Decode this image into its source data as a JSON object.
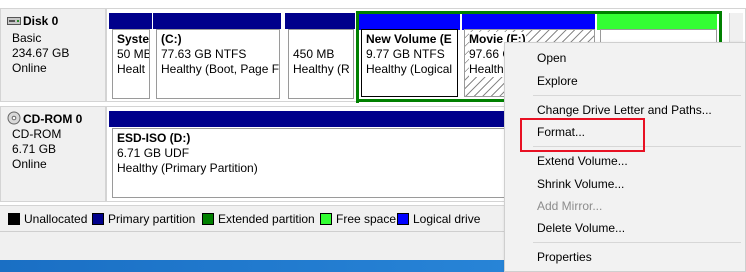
{
  "disk0": {
    "name": "Disk 0",
    "type": "Basic",
    "size": "234.67 GB",
    "status": "Online",
    "partitions": [
      {
        "title": "Syste",
        "line2": "50 MB",
        "line3": "Healt"
      },
      {
        "title": "(C:)",
        "line2": "77.63 GB NTFS",
        "line3": "Healthy (Boot, Page F"
      },
      {
        "title": "",
        "line2": "450 MB",
        "line3": "Healthy (R"
      },
      {
        "title": "New Volume  (E",
        "line2": "9.77 GB NTFS",
        "line3": "Healthy (Logical"
      },
      {
        "title": "Movie  (F:)",
        "line2": "97.66 G",
        "line3": "Health"
      }
    ]
  },
  "cdrom0": {
    "name": "CD-ROM 0",
    "type": "CD-ROM",
    "size": "6.71 GB",
    "status": "Online",
    "volume": {
      "title": "ESD-ISO  (D:)",
      "line2": "6.71 GB UDF",
      "line3": "Healthy (Primary Partition)"
    }
  },
  "legend": [
    {
      "label": "Unallocated",
      "color": "#000000"
    },
    {
      "label": "Primary partition",
      "color": "#00008b"
    },
    {
      "label": "Extended partition",
      "color": "#008000"
    },
    {
      "label": "Free space",
      "color": "#33ff33"
    },
    {
      "label": "Logical drive",
      "color": "#0000ff"
    }
  ],
  "context_menu": {
    "open": "Open",
    "explore": "Explore",
    "change_letter": "Change Drive Letter and Paths...",
    "format": "Format...",
    "extend": "Extend Volume...",
    "shrink": "Shrink Volume...",
    "add_mirror": "Add Mirror...",
    "delete": "Delete Volume...",
    "properties": "Properties"
  },
  "colors": {
    "primary": "#00008b",
    "extended": "#008000",
    "free_space": "#33ff33",
    "logical": "#0000ff",
    "highlight": "#e81123"
  }
}
